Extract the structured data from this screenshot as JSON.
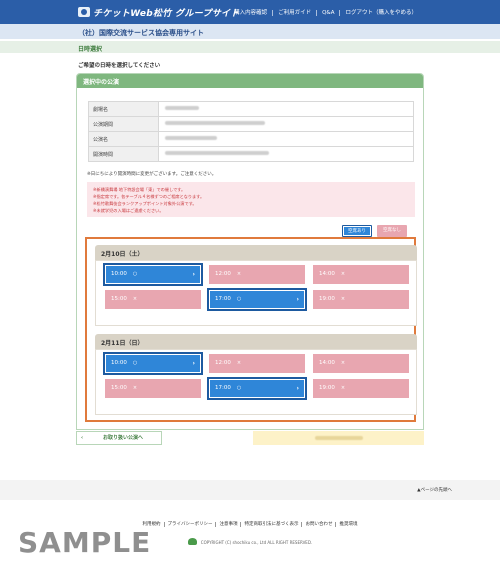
{
  "header": {
    "logo_text": "チケットWeb松竹 グループサイト",
    "nav": [
      "購入内容確認",
      "ご利用ガイド",
      "Q&A",
      "ログアウト（購入をやめる）"
    ]
  },
  "site_title": "（社）国際交流サービス協会専用サイト",
  "section_title": "日時選択",
  "lead": "ご希望の日時を選択してください",
  "panel": {
    "title": "選択中の公演",
    "rows": [
      {
        "key": "劇場名"
      },
      {
        "key": "公演期間"
      },
      {
        "key": "公演名"
      },
      {
        "key": "開演時間"
      }
    ],
    "note": "※日にちにより開演時間に変更がございます。ご注意ください。",
    "warnings": [
      "※新橋演舞場 地下特設会場「東」での催しです。",
      "※指定席です。各テーブル４名様ずつのご相席となります。",
      "※松竹歌舞伎会ランクアップポイント対象外公演です。",
      "※未就学児の入場はご遠慮ください。"
    ],
    "legend": {
      "available": "空席あり",
      "none": "空席なし"
    }
  },
  "dates": [
    {
      "label": "2月10日（土）",
      "slots": [
        {
          "time": "10:00",
          "mark": "○",
          "available": true
        },
        {
          "time": "12:00",
          "mark": "×",
          "available": false
        },
        {
          "time": "14:00",
          "mark": "×",
          "available": false
        },
        {
          "time": "15:00",
          "mark": "×",
          "available": false
        },
        {
          "time": "17:00",
          "mark": "○",
          "available": true
        },
        {
          "time": "19:00",
          "mark": "×",
          "available": false
        }
      ]
    },
    {
      "label": "2月11日（日）",
      "slots": [
        {
          "time": "10:00",
          "mark": "○",
          "available": true
        },
        {
          "time": "12:00",
          "mark": "×",
          "available": false
        },
        {
          "time": "14:00",
          "mark": "×",
          "available": false
        },
        {
          "time": "15:00",
          "mark": "×",
          "available": false
        },
        {
          "time": "17:00",
          "mark": "○",
          "available": true
        },
        {
          "time": "19:00",
          "mark": "×",
          "available": false
        }
      ]
    }
  ],
  "buttons": {
    "back": "お取り扱い公演へ",
    "page_top": "▲ページの先頭へ"
  },
  "footer": {
    "links": [
      "利用規約",
      "プライバシーポリシー",
      "注意事項",
      "特定商取引法に基づく表示",
      "お問い合わせ",
      "推奨環境"
    ],
    "copyright": "COPYRIGHT (C) shochiku co., Ltd ALL RIGHT RESERVED."
  },
  "watermark": "SAMPLE",
  "colors": {
    "header_blue": "#2b5ea8",
    "available_blue": "#2f86d8",
    "unavailable_pink": "#e8a6b0",
    "highlight_orange": "#e07a3c",
    "panel_green": "#7fb77f"
  }
}
